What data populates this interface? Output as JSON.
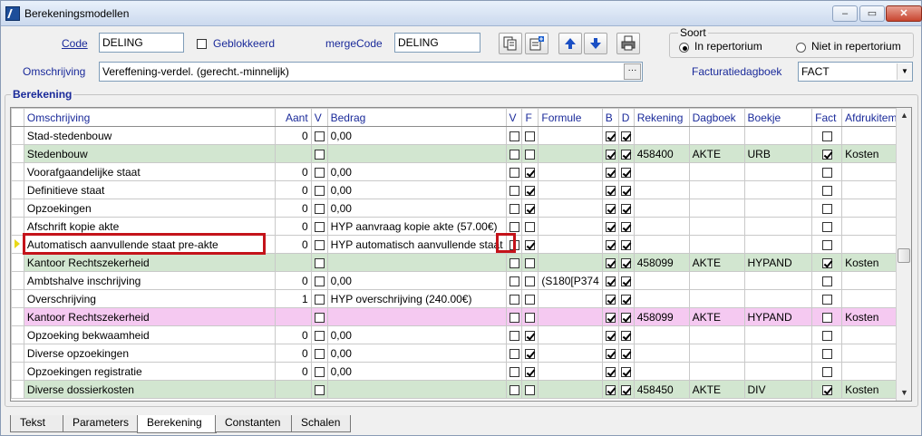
{
  "window": {
    "title": "Berekeningsmodellen",
    "minimize": "–",
    "maximize": "▭",
    "close": "✕"
  },
  "form": {
    "code_label": "Code",
    "code_value": "DELING",
    "geblokkeerd_label": "Geblokkeerd",
    "mergecode_label": "mergeCode",
    "mergecode_value": "DELING",
    "omschrijving_label": "Omschrijving",
    "omschrijving_value": "Vereffening-verdel. (gerecht.-minnelijk)",
    "ellipsis": "···",
    "soort_label": "Soort",
    "radio_in": "In repertorium",
    "radio_niet": "Niet in repertorium",
    "facturatiedagboek_label": "Facturatiedagboek",
    "facturatiedagboek_value": "FACT",
    "dropdown_arrow": "▼"
  },
  "toolbar": {
    "up_arrow": "🡅",
    "down_arrow": "🡇"
  },
  "section_label": "Berekening",
  "grid": {
    "headers": [
      "Omschrijving",
      "Aant",
      "V",
      "Bedrag",
      "V",
      "F",
      "Formule",
      "B",
      "D",
      "Rekening",
      "Dagboek",
      "Boekje",
      "Fact",
      "Afdrukitem"
    ],
    "rows": [
      {
        "type": "normal",
        "omschrijving": "Stad-stedenbouw",
        "aant": "0",
        "v": false,
        "bedrag": "0,00",
        "v2": false,
        "f": false,
        "formule": "",
        "b": true,
        "d": true,
        "rekening": "",
        "dagboek": "",
        "boekje": "",
        "fact": false,
        "afdruk": ""
      },
      {
        "type": "green",
        "omschrijving": "Stedenbouw",
        "aant": "",
        "v": false,
        "bedrag": "",
        "v2": false,
        "f": false,
        "formule": "",
        "b": true,
        "d": true,
        "rekening": "458400",
        "dagboek": "AKTE",
        "boekje": "URB",
        "fact": true,
        "afdruk": "Kosten"
      },
      {
        "type": "normal",
        "omschrijving": "Voorafgaandelijke staat",
        "aant": "0",
        "v": false,
        "bedrag": "0,00",
        "v2": false,
        "f": true,
        "formule": "",
        "b": true,
        "d": true,
        "rekening": "",
        "dagboek": "",
        "boekje": "",
        "fact": false,
        "afdruk": ""
      },
      {
        "type": "normal",
        "omschrijving": "Definitieve staat",
        "aant": "0",
        "v": false,
        "bedrag": "0,00",
        "v2": false,
        "f": true,
        "formule": "",
        "b": true,
        "d": true,
        "rekening": "",
        "dagboek": "",
        "boekje": "",
        "fact": false,
        "afdruk": ""
      },
      {
        "type": "normal",
        "omschrijving": "Opzoekingen",
        "aant": "0",
        "v": false,
        "bedrag": "0,00",
        "v2": false,
        "f": true,
        "formule": "",
        "b": true,
        "d": true,
        "rekening": "",
        "dagboek": "",
        "boekje": "",
        "fact": false,
        "afdruk": ""
      },
      {
        "type": "normal",
        "omschrijving": "Afschrift kopie akte",
        "aant": "0",
        "v": false,
        "bedrag": "HYP aanvraag kopie akte (57.00€)",
        "v2": false,
        "f": false,
        "formule": "",
        "b": true,
        "d": true,
        "rekening": "",
        "dagboek": "",
        "boekje": "",
        "fact": false,
        "afdruk": ""
      },
      {
        "type": "current",
        "omschrijving": "Automatisch aanvullende staat pre-akte",
        "aant": "0",
        "v": false,
        "bedrag": "HYP automatisch aanvullende staat",
        "v2": false,
        "f": true,
        "formule": "",
        "b": true,
        "d": true,
        "rekening": "",
        "dagboek": "",
        "boekje": "",
        "fact": false,
        "afdruk": ""
      },
      {
        "type": "green",
        "omschrijving": "Kantoor Rechtszekerheid",
        "aant": "",
        "v": false,
        "bedrag": "",
        "v2": false,
        "f": false,
        "formule": "",
        "b": true,
        "d": true,
        "rekening": "458099",
        "dagboek": "AKTE",
        "boekje": "HYPAND",
        "fact": true,
        "afdruk": "Kosten"
      },
      {
        "type": "normal",
        "omschrijving": "Ambtshalve inschrijving",
        "aant": "0",
        "v": false,
        "bedrag": "0,00",
        "v2": false,
        "f": false,
        "formule": "(S180[P374",
        "b": true,
        "d": true,
        "rekening": "",
        "dagboek": "",
        "boekje": "",
        "fact": false,
        "afdruk": ""
      },
      {
        "type": "normal",
        "omschrijving": "Overschrijving",
        "aant": "1",
        "v": false,
        "bedrag": "HYP overschrijving (240.00€)",
        "v2": false,
        "f": false,
        "formule": "",
        "b": true,
        "d": true,
        "rekening": "",
        "dagboek": "",
        "boekje": "",
        "fact": false,
        "afdruk": ""
      },
      {
        "type": "pink",
        "omschrijving": "Kantoor Rechtszekerheid",
        "aant": "",
        "v": false,
        "bedrag": "",
        "v2": false,
        "f": false,
        "formule": "",
        "b": true,
        "d": true,
        "rekening": "458099",
        "dagboek": "AKTE",
        "boekje": "HYPAND",
        "fact": false,
        "afdruk": "Kosten"
      },
      {
        "type": "normal",
        "omschrijving": "Opzoeking bekwaamheid",
        "aant": "0",
        "v": false,
        "bedrag": "0,00",
        "v2": false,
        "f": true,
        "formule": "",
        "b": true,
        "d": true,
        "rekening": "",
        "dagboek": "",
        "boekje": "",
        "fact": false,
        "afdruk": ""
      },
      {
        "type": "normal",
        "omschrijving": "Diverse opzoekingen",
        "aant": "0",
        "v": false,
        "bedrag": "0,00",
        "v2": false,
        "f": true,
        "formule": "",
        "b": true,
        "d": true,
        "rekening": "",
        "dagboek": "",
        "boekje": "",
        "fact": false,
        "afdruk": ""
      },
      {
        "type": "normal",
        "omschrijving": "Opzoekingen registratie",
        "aant": "0",
        "v": false,
        "bedrag": "0,00",
        "v2": false,
        "f": true,
        "formule": "",
        "b": true,
        "d": true,
        "rekening": "",
        "dagboek": "",
        "boekje": "",
        "fact": false,
        "afdruk": ""
      },
      {
        "type": "green",
        "omschrijving": "Diverse dossierkosten",
        "aant": "",
        "v": false,
        "bedrag": "",
        "v2": false,
        "f": false,
        "formule": "",
        "b": true,
        "d": true,
        "rekening": "458450",
        "dagboek": "AKTE",
        "boekje": "DIV",
        "fact": true,
        "afdruk": "Kosten"
      }
    ]
  },
  "scroll": {
    "up": "▲",
    "down": "▼"
  },
  "tabs": [
    "Tekst",
    "Parameters",
    "Berekening",
    "Constanten",
    "Schalen"
  ],
  "active_tab": "Berekening",
  "colors": {
    "group_green": "#d2e6d0",
    "group_pink": "#f5c9f1",
    "highlight": "#c4131a",
    "label_blue": "#1a2a9a"
  }
}
